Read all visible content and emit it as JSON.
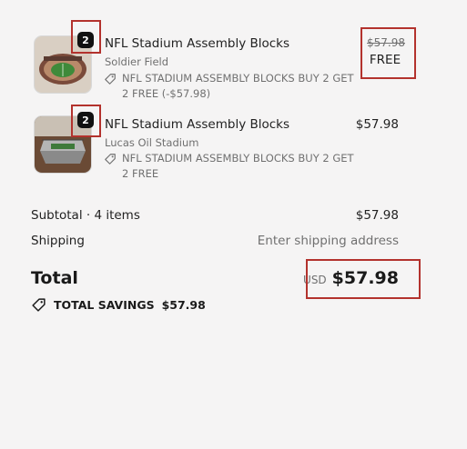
{
  "items": [
    {
      "quantity": "2",
      "name": "NFL Stadium Assembly Blocks",
      "variant": "Soldier Field",
      "discount": "NFL STADIUM ASSEMBLY BLOCKS BUY 2 GET 2 FREE (-$57.98)",
      "original_price": "$57.98",
      "price": "FREE",
      "image_icon": "stadium-model-image"
    },
    {
      "quantity": "2",
      "name": "NFL Stadium Assembly Blocks",
      "variant": "Lucas Oil Stadium",
      "discount": "NFL STADIUM ASSEMBLY BLOCKS BUY 2 GET 2 FREE",
      "price": "$57.98",
      "image_icon": "stadium-model-image"
    }
  ],
  "summary": {
    "subtotal_label": "Subtotal · 4 items",
    "subtotal_value": "$57.98",
    "shipping_label": "Shipping",
    "shipping_value": "Enter shipping address"
  },
  "total": {
    "label": "Total",
    "currency": "USD",
    "amount": "$57.98"
  },
  "savings": {
    "label": "TOTAL SAVINGS",
    "amount": "$57.98",
    "icon": "tag-icon"
  },
  "colors": {
    "background": "#f5f4f4",
    "highlight": "#b3322d",
    "badge": "#111111"
  }
}
